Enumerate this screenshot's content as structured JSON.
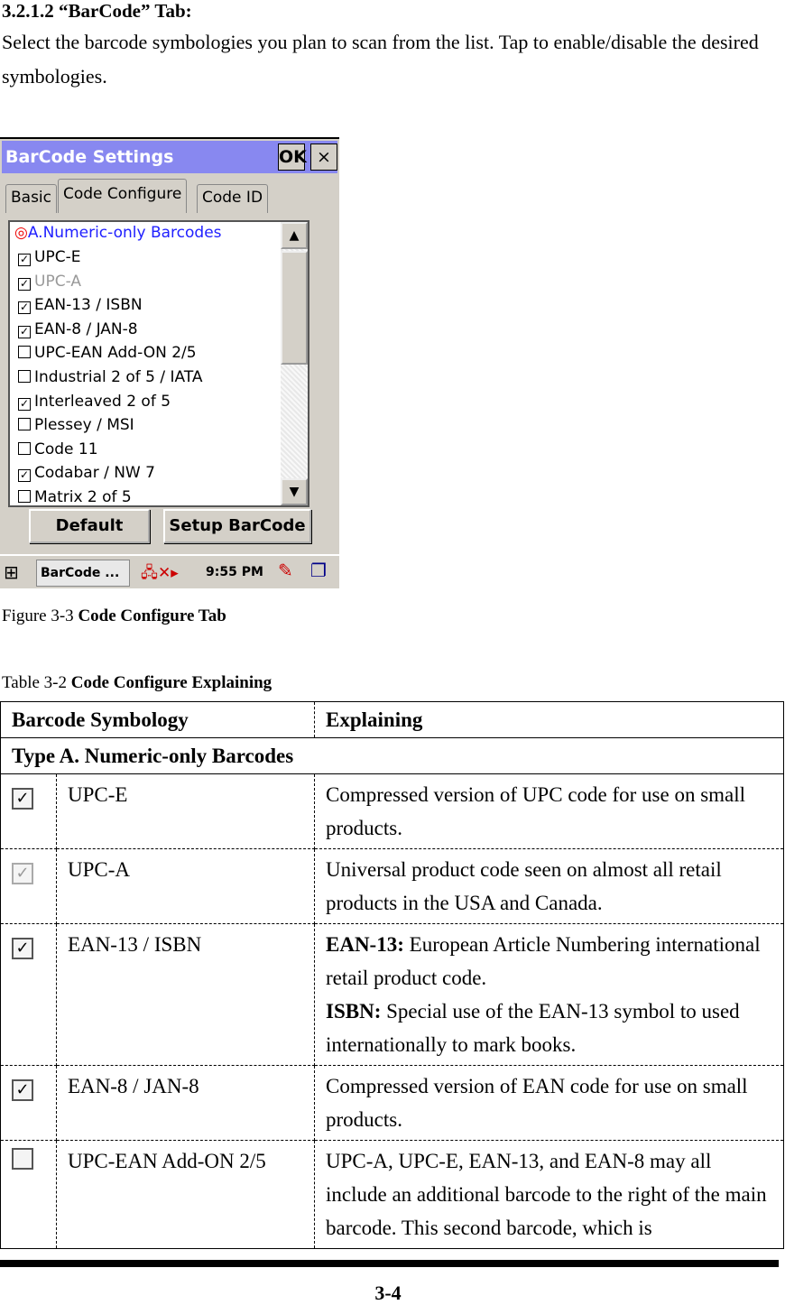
{
  "heading": "3.2.1.2 “BarCode” Tab:",
  "intro": "Select the barcode symbologies you plan to scan from the list. Tap to enable/disable the desired symbologies.",
  "screenshot": {
    "title": "BarCode Settings",
    "ok": "OK",
    "close": "×",
    "tabs": [
      "Basic",
      "Code Configure",
      "Code ID"
    ],
    "group": "A.Numeric-only Barcodes",
    "items": [
      {
        "label": "UPC-E",
        "checked": true
      },
      {
        "label": "UPC-A",
        "checked": true,
        "disabled": true
      },
      {
        "label": "EAN-13 / ISBN",
        "checked": true
      },
      {
        "label": "EAN-8 / JAN-8",
        "checked": true
      },
      {
        "label": "UPC-EAN Add-ON 2/5",
        "checked": false
      },
      {
        "label": "Industrial 2 of 5 / IATA",
        "checked": false
      },
      {
        "label": "Interleaved 2 of 5",
        "checked": true
      },
      {
        "label": "Plessey / MSI",
        "checked": false
      },
      {
        "label": "Code 11",
        "checked": false
      },
      {
        "label": "Codabar / NW 7",
        "checked": true
      },
      {
        "label": "Matrix 2 of 5",
        "checked": false
      }
    ],
    "default_btn": "Default",
    "setup_btn": "Setup BarCode",
    "taskbar_app": "BarCode ...",
    "time": "9:55 PM"
  },
  "figure_caption": {
    "prefix": "Figure 3-3 ",
    "title": "Code Configure Tab"
  },
  "table_caption": {
    "prefix": "Table 3-2 ",
    "title": "Code Configure Explaining"
  },
  "table": {
    "headers": [
      "Barcode Symbology",
      "Explaining"
    ],
    "group": "Type A. Numeric-only Barcodes",
    "rows": [
      {
        "checked": true,
        "name": "UPC-E",
        "desc": "Compressed version of UPC code for use on small products."
      },
      {
        "checked": true,
        "disabled": true,
        "name": "UPC-A",
        "desc": "Universal product code seen on almost all retail products in the USA and Canada."
      },
      {
        "checked": true,
        "name": "EAN-13 / ISBN",
        "b1": "EAN-13:",
        "d1": " European Article Numbering international retail product code.",
        "b2": "ISBN:",
        "d2": " Special use of the EAN-13 symbol to used internationally to mark books."
      },
      {
        "checked": true,
        "name": "EAN-8 / JAN-8",
        "desc": "Compressed version of EAN code for use on small products."
      },
      {
        "checked": false,
        "name": "UPC-EAN Add-ON 2/5",
        "desc": "UPC-A, UPC-E, EAN-13, and EAN-8 may all include an additional barcode to the right of the main barcode. This second barcode, which is"
      }
    ]
  },
  "page_number": "3-4"
}
